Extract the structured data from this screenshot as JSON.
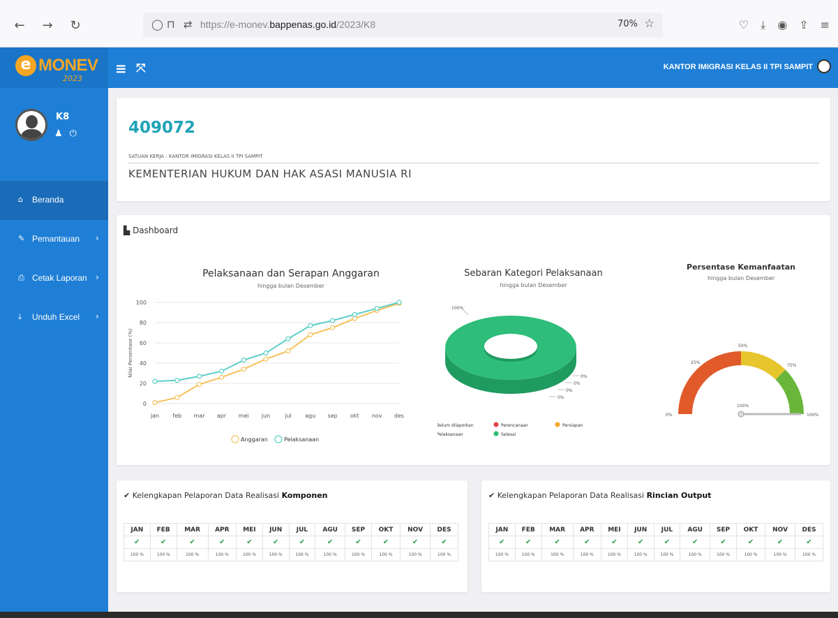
{
  "browser": {
    "url_prefix": "https://e-monev.",
    "url_domain": "bappenas.go.id",
    "url_path": "/2023/K8",
    "zoom": "70%"
  },
  "app": {
    "logo_e": "e",
    "logo_text": "MONEV",
    "logo_year": "2023",
    "office": "KANTOR IMIGRASI KELAS II TPI SAMPIT",
    "user": "K8"
  },
  "sidebar": {
    "items": [
      {
        "label": "Beranda"
      },
      {
        "label": "Pemantauan"
      },
      {
        "label": "Cetak Laporan"
      },
      {
        "label": "Unduh Excel"
      }
    ]
  },
  "header": {
    "code": "409072",
    "satker": "SATUAN KERJA : KANTOR IMIGRASI KELAS II TPI SAMPIT",
    "ministry": "KEMENTERIAN HUKUM DAN HAK ASASI MANUSIA RI"
  },
  "dashboard": {
    "title": "Dashboard"
  },
  "colors": {
    "primary": "#1f7fd6",
    "teal": "#5ccfc7",
    "orange": "#f5c25a",
    "green": "#2ebd7a",
    "check": "#2e9e4a"
  },
  "chart_data": [
    {
      "type": "line",
      "title": "Pelaksanaan dan Serapan Anggaran",
      "subtitle": "hingga bulan Desember",
      "ylabel": "Nilai Persentase (%)",
      "ylim": [
        0,
        100
      ],
      "yticks": [
        0,
        20,
        40,
        60,
        80,
        100
      ],
      "categories": [
        "jan",
        "feb",
        "mar",
        "apr",
        "mei",
        "jun",
        "jul",
        "agu",
        "sep",
        "okt",
        "nov",
        "des"
      ],
      "series": [
        {
          "name": "Anggaran",
          "color": "#f5c25a",
          "values": [
            1,
            6,
            19,
            26,
            34,
            44,
            52,
            68,
            75,
            84,
            92,
            99
          ]
        },
        {
          "name": "Pelaksanaan",
          "color": "#5ccfc7",
          "values": [
            22,
            23,
            27,
            32,
            43,
            50,
            64,
            77,
            82,
            88,
            94,
            100
          ]
        }
      ]
    },
    {
      "type": "pie",
      "title": "Sebaran Kategori Pelaksanaan",
      "subtitle": "hingga bulan Desember",
      "slices": [
        {
          "name": "Belum dilaporkan",
          "value": 0,
          "label": "0%",
          "color": "#1e4f7a"
        },
        {
          "name": "Perencanaan",
          "value": 0,
          "label": "0%",
          "color": "#e0404a"
        },
        {
          "name": "Persiapan",
          "value": 0,
          "label": "0%",
          "color": "#f5a623"
        },
        {
          "name": "Pelaksanaan",
          "value": 0,
          "label": "0%",
          "color": "#2f8fe0"
        },
        {
          "name": "Selesai",
          "value": 100,
          "label": "100%",
          "color": "#2ebd7a"
        }
      ]
    },
    {
      "type": "gauge",
      "title": "Persentase Kemanfaatan",
      "subtitle": "hingga bulan Desember",
      "value": 100,
      "value_label": "100%",
      "ticks": [
        "0%",
        "25%",
        "50%",
        "75%",
        "100%"
      ]
    }
  ],
  "komponen": {
    "title_prefix": "Kelengkapan Pelaporan Data Realisasi ",
    "title_bold": "Komponen",
    "months": [
      "JAN",
      "FEB",
      "MAR",
      "APR",
      "MEI",
      "JUN",
      "JUL",
      "AGU",
      "SEP",
      "OKT",
      "NOV",
      "DES"
    ],
    "values": [
      "100 %",
      "100 %",
      "100 %",
      "100 %",
      "100 %",
      "100 %",
      "100 %",
      "100 %",
      "100 %",
      "100 %",
      "100 %",
      "100 %"
    ]
  },
  "rincian": {
    "title_prefix": "Kelengkapan Pelaporan Data Realisasi ",
    "title_bold": "Rincian Output",
    "months": [
      "JAN",
      "FEB",
      "MAR",
      "APR",
      "MEI",
      "JUN",
      "JUL",
      "AGU",
      "SEP",
      "OKT",
      "NOV",
      "DES"
    ],
    "values": [
      "100 %",
      "100 %",
      "100 %",
      "100 %",
      "100 %",
      "100 %",
      "100 %",
      "100 %",
      "100 %",
      "100 %",
      "100 %",
      "100 %"
    ]
  }
}
